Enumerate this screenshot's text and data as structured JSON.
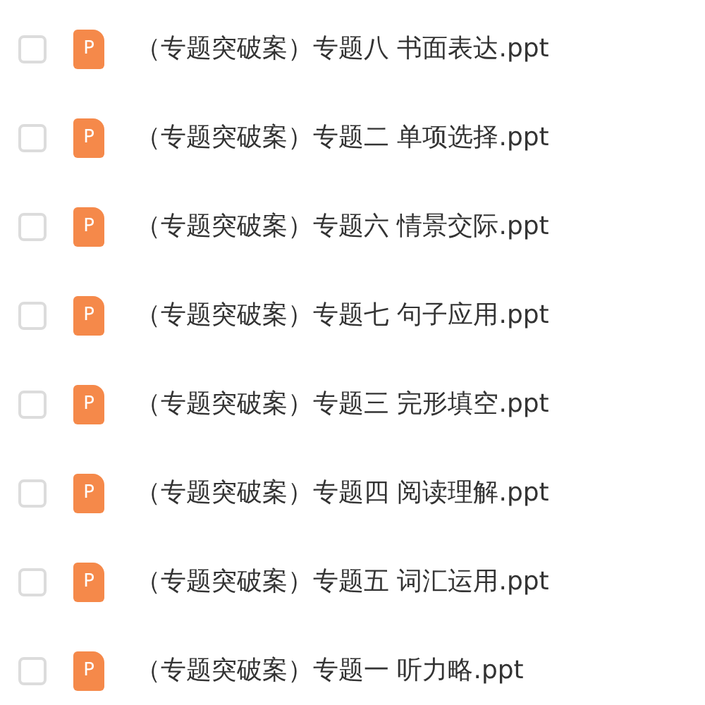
{
  "files": [
    {
      "name": "（专题突破案）专题八 书面表达.ppt",
      "icon_label": "P",
      "checked": false
    },
    {
      "name": "（专题突破案）专题二 单项选择.ppt",
      "icon_label": "P",
      "checked": false
    },
    {
      "name": "（专题突破案）专题六 情景交际.ppt",
      "icon_label": "P",
      "checked": false
    },
    {
      "name": "（专题突破案）专题七 句子应用.ppt",
      "icon_label": "P",
      "checked": false
    },
    {
      "name": "（专题突破案）专题三 完形填空.ppt",
      "icon_label": "P",
      "checked": false
    },
    {
      "name": "（专题突破案）专题四 阅读理解.ppt",
      "icon_label": "P",
      "checked": false
    },
    {
      "name": "（专题突破案）专题五 词汇运用.ppt",
      "icon_label": "P",
      "checked": false
    },
    {
      "name": "（专题突破案）专题一 听力略.ppt",
      "icon_label": "P",
      "checked": false
    }
  ]
}
